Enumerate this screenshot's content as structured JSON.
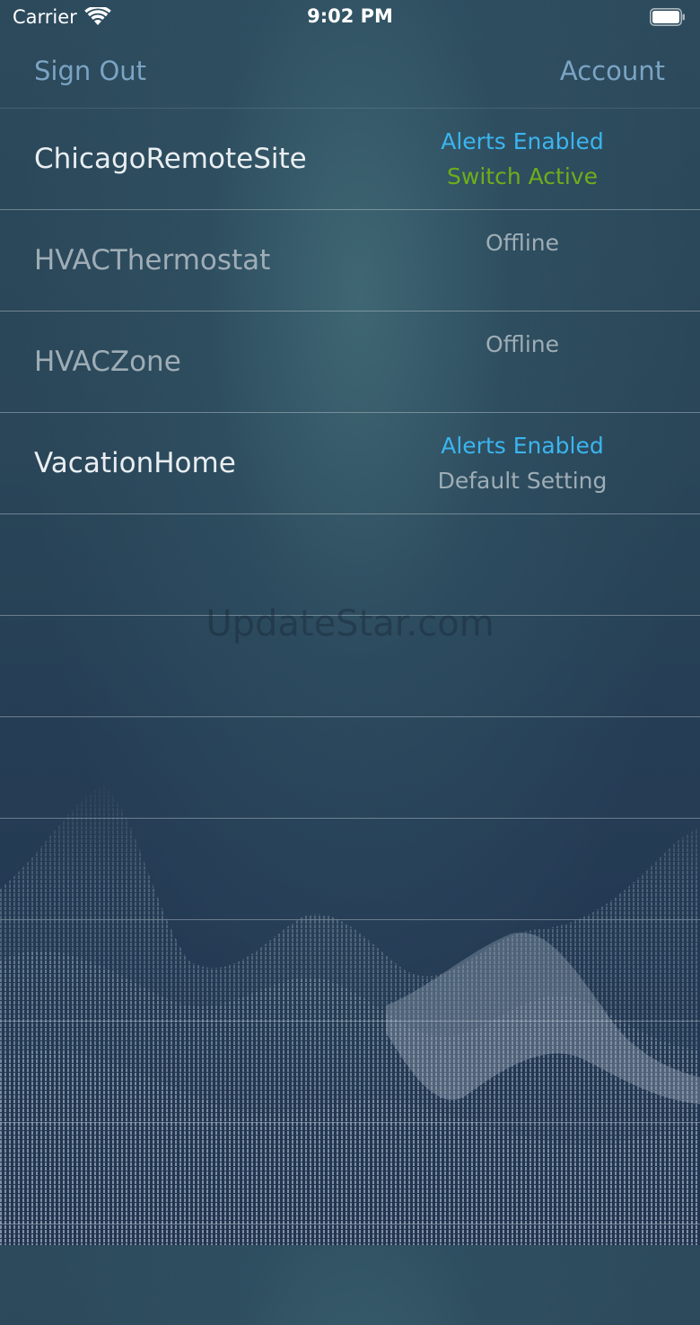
{
  "status_bar": {
    "carrier": "Carrier",
    "time": "9:02 PM",
    "icons": [
      "wifi-icon",
      "battery-icon"
    ]
  },
  "nav": {
    "sign_out": "Sign Out",
    "account": "Account"
  },
  "colors": {
    "nav_link": "#7ba4c4",
    "alerts_enabled": "#3bb5ef",
    "switch_active": "#6fae1a",
    "muted_status": "#9fadb6",
    "online_title": "#e9eef1",
    "offline_title": "#9fadb6"
  },
  "sites": [
    {
      "name": "ChicagoRemoteSite",
      "state": "online",
      "status_line_1": "Alerts Enabled",
      "status_line_1_color": "#3bb5ef",
      "status_line_2": "Switch Active",
      "status_line_2_color": "#6fae1a"
    },
    {
      "name": "HVACThermostat",
      "state": "offline",
      "status_line_1": "Offline",
      "status_line_1_color": "#9fadb6",
      "status_line_2": "",
      "status_line_2_color": "#9fadb6"
    },
    {
      "name": "HVACZone",
      "state": "offline",
      "status_line_1": "Offline",
      "status_line_1_color": "#9fadb6",
      "status_line_2": "",
      "status_line_2_color": "#9fadb6"
    },
    {
      "name": "VacationHome",
      "state": "online",
      "status_line_1": "Alerts Enabled",
      "status_line_1_color": "#3bb5ef",
      "status_line_2": "Default Setting",
      "status_line_2_color": "#9fadb6"
    }
  ],
  "watermark": "UpdateStar.com"
}
